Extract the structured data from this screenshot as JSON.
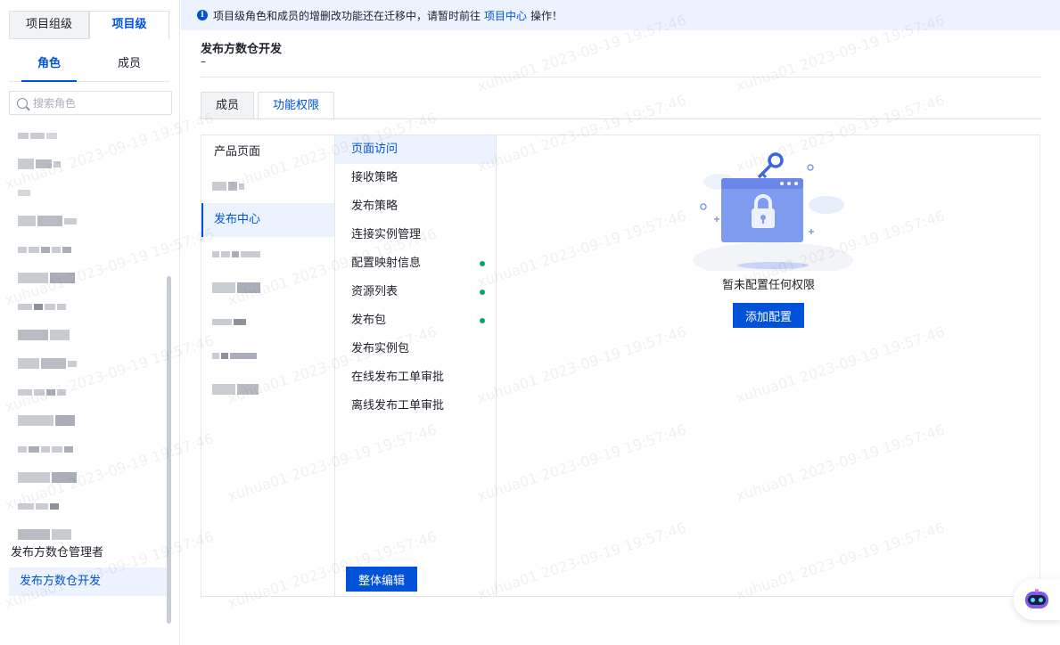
{
  "left": {
    "scope_tabs": [
      "项目组级",
      "项目级"
    ],
    "sub_tabs": [
      "角色",
      "成员"
    ],
    "search_placeholder": "搜索角色",
    "roles": [
      "发布方数仓管理者",
      "发布方数仓开发"
    ]
  },
  "banner": {
    "text_before": "项目级角色和成员的增删改功能还在迁移中，请暂时前往",
    "link": "项目中心",
    "text_after": "操作！"
  },
  "main": {
    "role_title": "发布方数仓开发",
    "role_desc": "–",
    "tabs": [
      "成员",
      "功能权限"
    ],
    "modules": [
      "产品页面",
      "发布中心"
    ],
    "pages": [
      {
        "label": "页面访问",
        "configured": false
      },
      {
        "label": "接收策略",
        "configured": false
      },
      {
        "label": "发布策略",
        "configured": false
      },
      {
        "label": "连接实例管理",
        "configured": false
      },
      {
        "label": "配置映射信息",
        "configured": true
      },
      {
        "label": "资源列表",
        "configured": true
      },
      {
        "label": "发布包",
        "configured": true
      },
      {
        "label": "发布实例包",
        "configured": false
      },
      {
        "label": "在线发布工单审批",
        "configured": false
      },
      {
        "label": "离线发布工单审批",
        "configured": false
      }
    ],
    "edit_button": "整体编辑",
    "empty_text": "暂未配置任何权限",
    "add_button": "添加配置"
  },
  "watermark": "xuhua01 2023-09-19 19:57:46",
  "colors": {
    "primary": "#0052d9",
    "success": "#00a870",
    "highlight_bg": "#ecf2fe"
  }
}
